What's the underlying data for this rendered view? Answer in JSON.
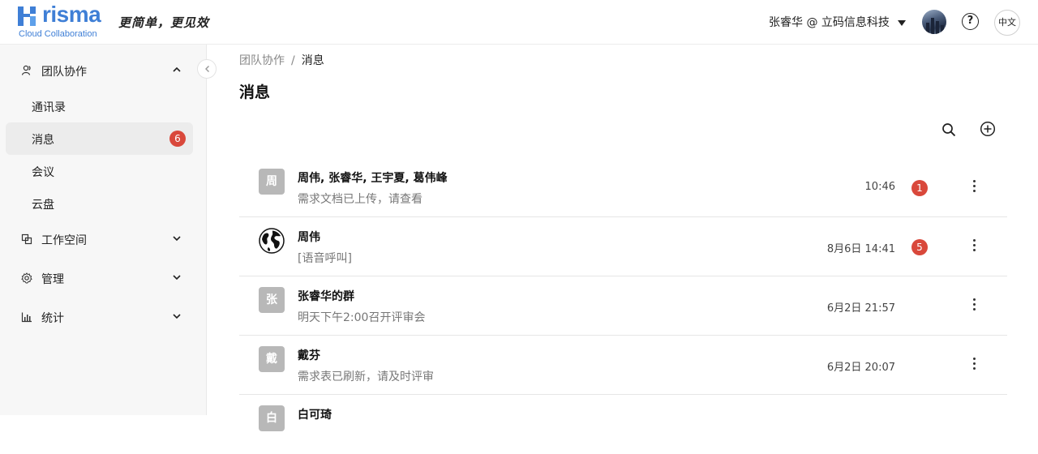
{
  "header": {
    "logo_word": "risma",
    "logo_sub": "Cloud Collaboration",
    "slogan": "更简单，更见效",
    "user_label": "张睿华 @ 立码信息科技",
    "help_symbol": "?",
    "lang_label": "中文"
  },
  "sidebar": {
    "groups": [
      {
        "label": "团队协作",
        "icon": "team-icon",
        "expanded": true
      },
      {
        "label": "工作空间",
        "icon": "workspace-icon",
        "expanded": false
      },
      {
        "label": "管理",
        "icon": "gear-icon",
        "expanded": false
      },
      {
        "label": "统计",
        "icon": "bar-chart-icon",
        "expanded": false
      }
    ],
    "team_items": [
      {
        "label": "通讯录"
      },
      {
        "label": "消息",
        "badge": "6",
        "active": true
      },
      {
        "label": "会议"
      },
      {
        "label": "云盘"
      }
    ]
  },
  "breadcrumb": {
    "parent": "团队协作",
    "separator": "/",
    "current": "消息"
  },
  "page_title": "消息",
  "messages": [
    {
      "avatar_text": "周",
      "title": "周伟, 张睿华, 王宇夏, 葛伟峰",
      "preview": "需求文档已上传，请查看",
      "time": "10:46",
      "badge": "1"
    },
    {
      "avatar_icon": "globe-icon",
      "title": "周伟",
      "preview": "[语音呼叫]",
      "time": "8月6日 14:41",
      "badge": "5"
    },
    {
      "avatar_text": "张",
      "title": "张睿华的群",
      "preview": "明天下午2:00召开评审会",
      "time": "6月2日 21:57"
    },
    {
      "avatar_text": "戴",
      "title": "戴芬",
      "preview": "需求表已刷新，请及时评审",
      "time": "6月2日 20:07"
    },
    {
      "avatar_text": "白",
      "title": "白可琦",
      "preview": "",
      "time": ""
    }
  ],
  "colors": {
    "brand": "#3f7fd6",
    "badge": "#d9483b",
    "active_bg": "#ececec"
  }
}
